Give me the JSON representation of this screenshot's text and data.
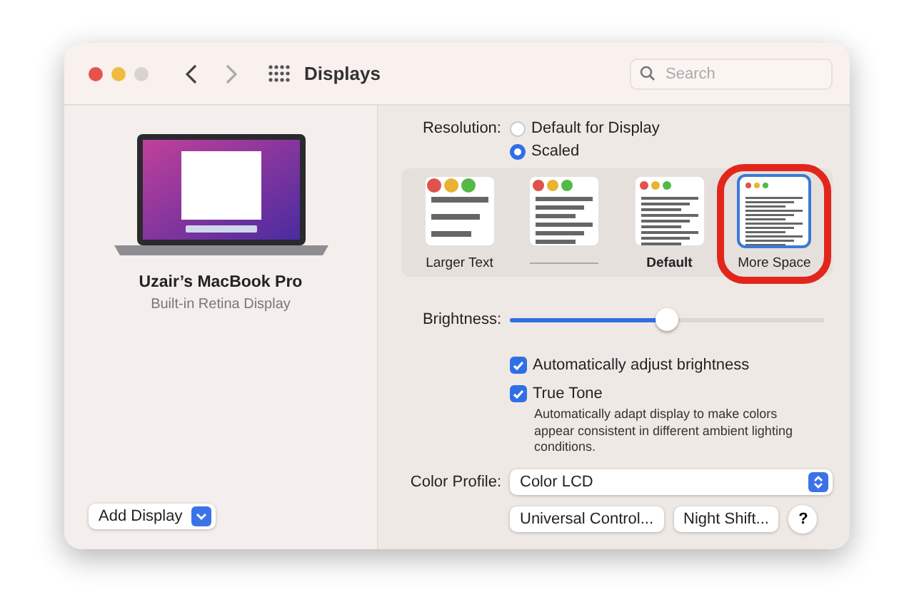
{
  "window": {
    "title": "Displays",
    "search": {
      "placeholder": "Search"
    }
  },
  "display": {
    "name": "Uzair’s MacBook Pro",
    "subtitle": "Built-in Retina Display"
  },
  "add_display": {
    "label": "Add Display"
  },
  "resolution": {
    "label": "Resolution:",
    "options": [
      {
        "label": "Default for Display",
        "selected": false
      },
      {
        "label": "Scaled",
        "selected": true
      }
    ]
  },
  "scale_options": [
    {
      "label": "Larger Text",
      "selected": false,
      "highlighted": false
    },
    {
      "selected": false,
      "highlighted": false
    },
    {
      "label": "Default",
      "selected": false,
      "highlighted": false
    },
    {
      "label": "More Space",
      "selected": true,
      "highlighted": true
    }
  ],
  "brightness": {
    "label": "Brightness:",
    "level": 0.5
  },
  "checkboxes": [
    {
      "label": "Automatically adjust brightness",
      "checked": true
    },
    {
      "label": "True Tone",
      "checked": true,
      "description": "Automatically adapt display to make colors appear consistent in different ambient lighting conditions."
    }
  ],
  "color_profile": {
    "label": "Color Profile:",
    "value": "Color LCD"
  },
  "buttons": [
    {
      "label": "Universal Control..."
    },
    {
      "label": "Night Shift..."
    },
    {
      "label": "?"
    }
  ]
}
